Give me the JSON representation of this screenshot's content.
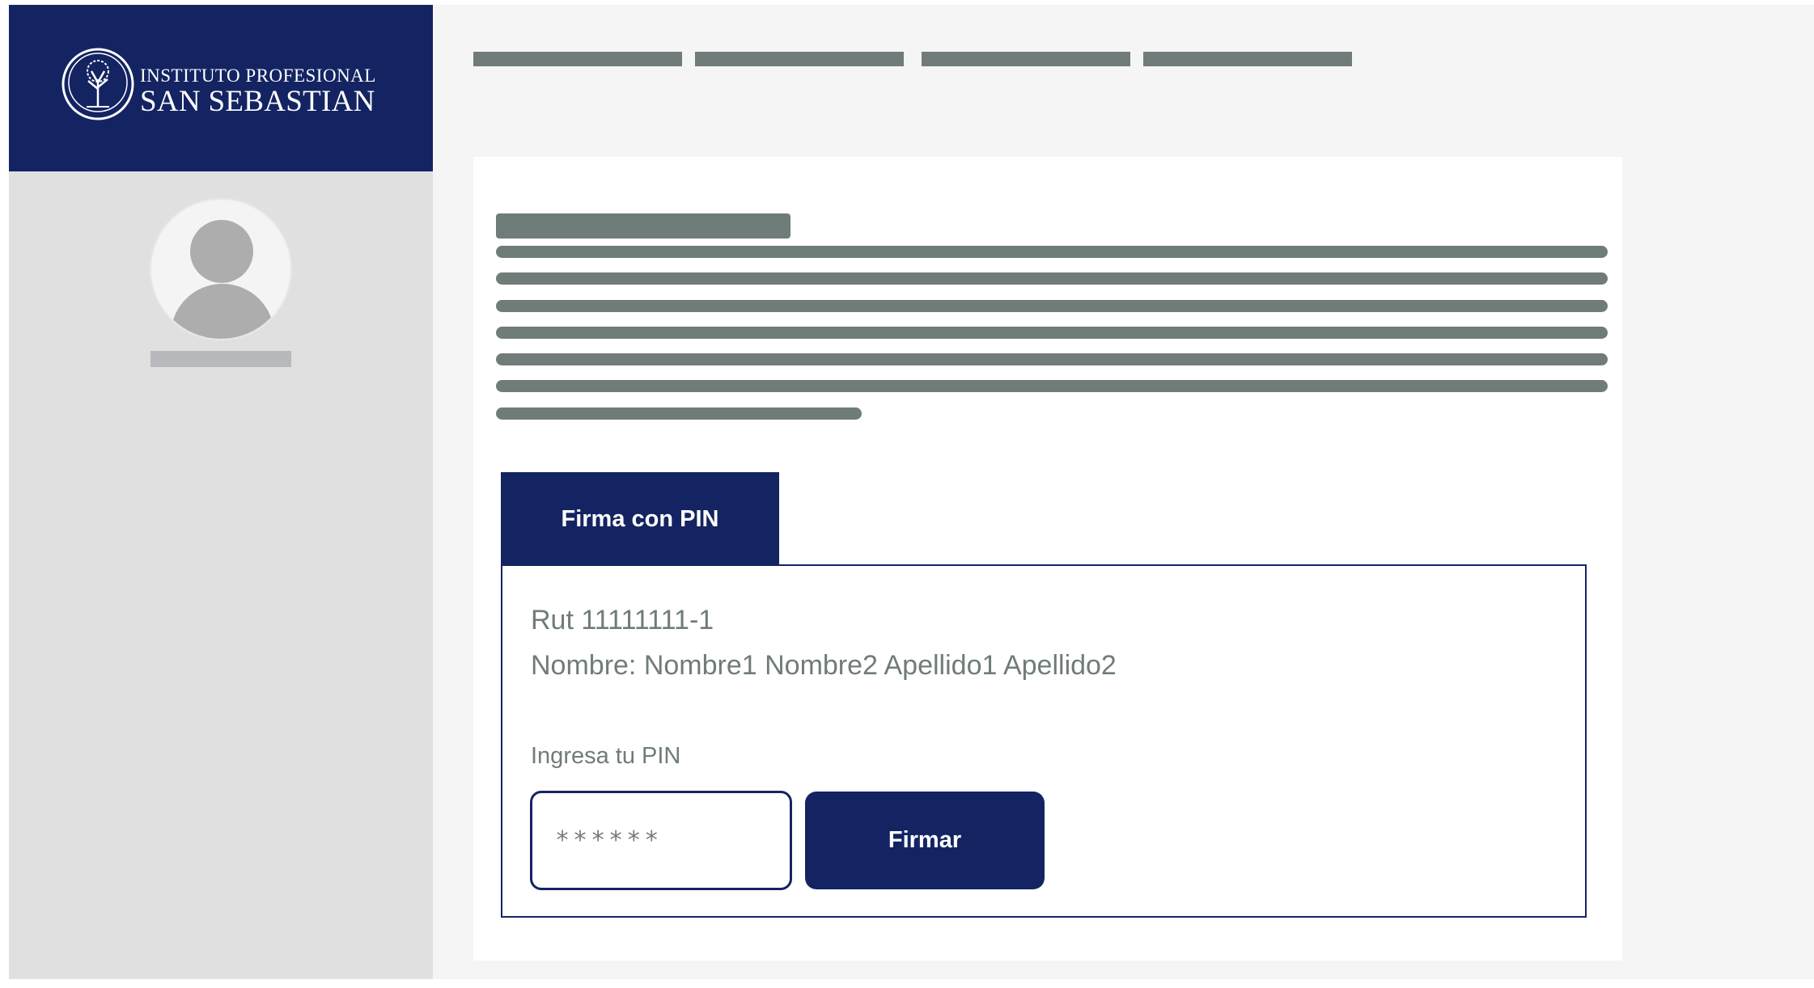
{
  "brand": {
    "line1": "INSTITUTO PROFESIONAL",
    "line2": "SAN SEBASTIAN",
    "emblem_icon": "tree-emblem-icon",
    "color": "#142462"
  },
  "sidebar": {
    "avatar_icon": "user-avatar-icon"
  },
  "signature": {
    "tab_label": "Firma con PIN",
    "rut": "Rut 11111111-1",
    "nombre": "Nombre: Nombre1 Nombre2 Apellido1 Apellido2",
    "pin_label": "Ingresa tu PIN",
    "pin_placeholder": "******",
    "button_label": "Firmar"
  }
}
